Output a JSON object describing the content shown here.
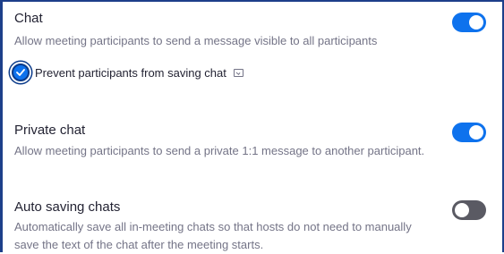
{
  "settings": [
    {
      "title": "Chat",
      "description": "Allow meeting participants to send a message visible to all participants",
      "toggle": "on"
    },
    {
      "title": "Private chat",
      "description": "Allow meeting participants to send a private 1:1 message to another participant.",
      "toggle": "on"
    },
    {
      "title": "Auto saving chats",
      "description": "Automatically save all in-meeting chats so that hosts do not need to manually save the text of the chat after the meeting starts.",
      "toggle": "off"
    }
  ],
  "chat_option": {
    "label": "Prevent participants from saving chat",
    "checked": true,
    "info_icon": "info-icon"
  },
  "colors": {
    "toggle_on": "#0e72ed",
    "toggle_off": "#5a5a63",
    "title": "#232333",
    "description": "#747487",
    "frame": "#1d3f8a"
  }
}
